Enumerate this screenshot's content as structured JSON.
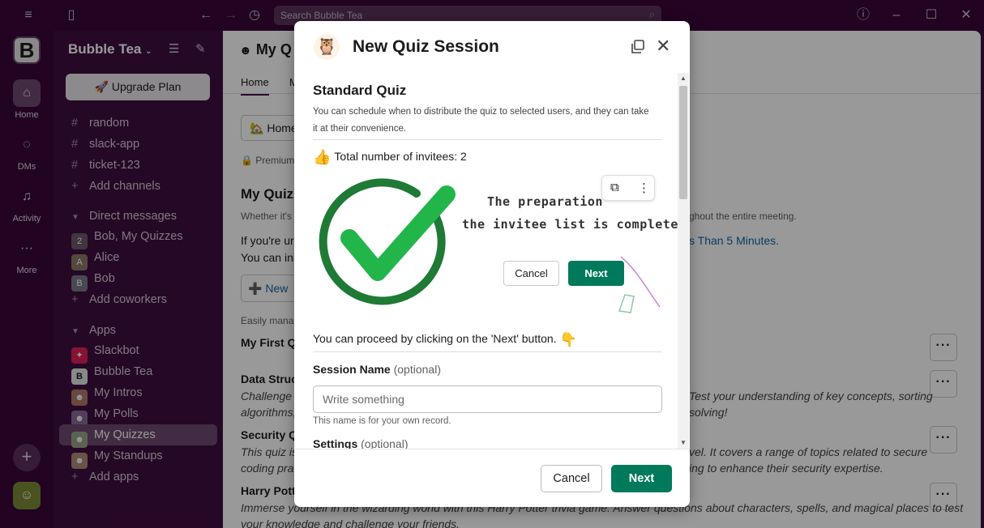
{
  "topbar": {
    "search_placeholder": "Search Bubble Tea",
    "menu_icon": "hamburger-icon",
    "icons": [
      "sidebar-toggle-icon",
      "back-arrow-icon",
      "forward-arrow-icon",
      "history-icon",
      "help-icon",
      "minimize-icon",
      "maximize-icon",
      "close-icon"
    ]
  },
  "rail": {
    "workspace_initial": "B",
    "items": [
      {
        "label": "Home",
        "icon": "home-icon"
      },
      {
        "label": "DMs",
        "icon": "dms-icon"
      },
      {
        "label": "Activity",
        "icon": "bell-icon"
      },
      {
        "label": "More",
        "icon": "more-icon"
      }
    ]
  },
  "sidebar": {
    "workspace_name": "Bubble Tea",
    "upgrade_label": "Upgrade Plan",
    "channels": [
      "random",
      "slack-app",
      "ticket-123"
    ],
    "add_channels": "Add channels",
    "dm_section": "Direct messages",
    "dms": [
      {
        "name": "Bob, My Quizzes",
        "badge": "2"
      },
      {
        "name": "Alice"
      },
      {
        "name": "Bob"
      }
    ],
    "add_coworkers": "Add coworkers",
    "apps_section": "Apps",
    "apps": [
      "Slackbot",
      "Bubble Tea",
      "My Intros",
      "My Polls",
      "My Quizzes",
      "My Standups"
    ],
    "add_apps": "Add apps"
  },
  "main": {
    "title": "My Q",
    "tabs": [
      "Home",
      "M"
    ],
    "home_button": "Home",
    "premium": "Premium",
    "heading": "My Quiz",
    "sub": "Whether it's",
    "sub_right": "ghout the entire meeting.",
    "line1": "If you're ur",
    "line1_link": "s Than 5 Minutes.",
    "line2": "You can ini",
    "new_button": "New",
    "easily": "Easily manag",
    "quiz1": "My First Q",
    "quiz2": "Data Struc",
    "quiz2_desc_a": "Challenge y",
    "quiz2_desc_a_right": "Test your understanding of key concepts, sorting",
    "quiz2_desc_b": "algorithms,",
    "quiz2_desc_b_right": "solving!",
    "quiz3": "Security Q",
    "quiz3_desc_a": "This quiz is",
    "quiz3_desc_a_right": "vel. It covers a range of topics related to secure",
    "quiz3_desc_b": "coding prac",
    "quiz3_desc_b_right": "ing to enhance their security expertise.",
    "quiz4": "Harry Potte",
    "quiz4_desc": "Immerse yourself in the wizarding world with this Harry Potter trivia game. Answer questions about characters, spells, and magical places to test",
    "quiz4_desc_b": "your knowledge and challenge your friends."
  },
  "modal": {
    "title": "New Quiz Session",
    "section_title": "Standard Quiz",
    "description": "You can schedule when to distribute the quiz to selected users, and they can take it at their convenience.",
    "invitees": "Total number of invitees: 2",
    "illustration": {
      "line1": "The preparation",
      "line2": "the invitee list is complete.",
      "cancel": "Cancel",
      "next": "Next"
    },
    "proceed_text": "You can proceed by clicking on the 'Next' button.",
    "session_name_label": "Session Name",
    "optional": "(optional)",
    "session_placeholder": "Write something",
    "session_hint": "This name is for your own record.",
    "settings_label": "Settings",
    "cancel_label": "Cancel",
    "next_label": "Next"
  },
  "colors": {
    "aubergine": "#3f0e40",
    "primary_green": "#007a5a",
    "link_blue": "#1264a3"
  }
}
